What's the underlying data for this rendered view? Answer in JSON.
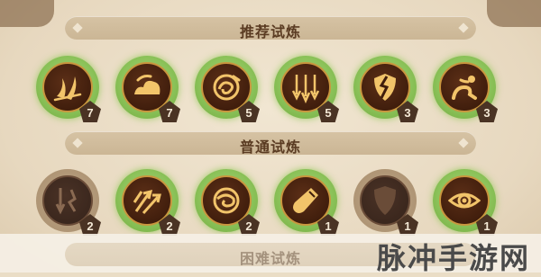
{
  "sections": {
    "recommended": {
      "title": "推荐试炼"
    },
    "normal": {
      "title": "普通试炼"
    },
    "hard": {
      "title": "困难试炼"
    }
  },
  "recommended_skills": [
    {
      "icon": "claw-slash-icon",
      "level": "7",
      "active": true
    },
    {
      "icon": "cloud-wave-icon",
      "level": "7",
      "active": true
    },
    {
      "icon": "swirl-orb-icon",
      "level": "5",
      "active": true
    },
    {
      "icon": "triple-arrow-down-icon",
      "level": "5",
      "active": true
    },
    {
      "icon": "broken-shield-icon",
      "level": "3",
      "active": true
    },
    {
      "icon": "crouching-figure-icon",
      "level": "3",
      "active": true
    }
  ],
  "normal_skills": [
    {
      "icon": "falling-arrows-icon",
      "level": "2",
      "active": false
    },
    {
      "icon": "arrow-burst-icon",
      "level": "2",
      "active": true
    },
    {
      "icon": "spiral-orb-icon",
      "level": "2",
      "active": true
    },
    {
      "icon": "potion-flask-icon",
      "level": "1",
      "active": true
    },
    {
      "icon": "shield-icon",
      "level": "1",
      "active": false
    },
    {
      "icon": "eye-icon",
      "level": "1",
      "active": true
    }
  ],
  "watermark": "脉冲手游网",
  "colors": {
    "active_ring": "#8cc35a",
    "icon_gold": "#f2c46a",
    "badge_bg": "#4a3324",
    "title_text": "#5a3b22"
  }
}
